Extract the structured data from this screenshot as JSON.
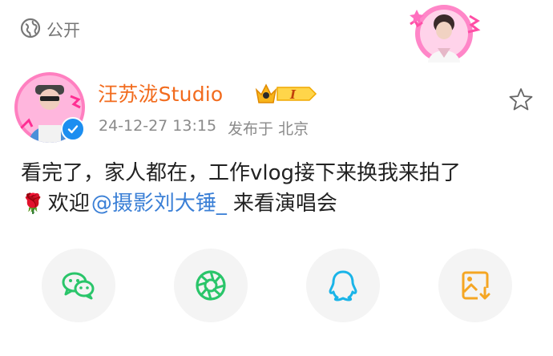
{
  "visibility": {
    "icon": "globe-icon",
    "label": "公开"
  },
  "author": {
    "name": "汪苏泷Studio",
    "badge_level": "I",
    "verified": true,
    "timestamp": "24-12-27 13:15",
    "location_text": "发布于 北京"
  },
  "post": {
    "line1": "看完了，家人都在，工作vlog接下来换我来拍了",
    "rose_emoji": "🌹",
    "line2_prefix": "欢迎",
    "mention": "@摄影刘大锤_",
    "line2_suffix": "来看演唱会"
  },
  "share_buttons": [
    {
      "name": "wechat",
      "icon": "wechat-icon",
      "color": "#2ac56a"
    },
    {
      "name": "moments",
      "icon": "moments-icon",
      "color": "#2ac56a"
    },
    {
      "name": "qq",
      "icon": "qq-icon",
      "color": "#1ab4e8"
    },
    {
      "name": "save-image",
      "icon": "save-image-icon",
      "color": "#f5a623"
    }
  ],
  "colors": {
    "username": "#f26b1d",
    "mention": "#3a7fd6",
    "meta": "#8a8a8a",
    "verified": "#1c8ef0"
  }
}
